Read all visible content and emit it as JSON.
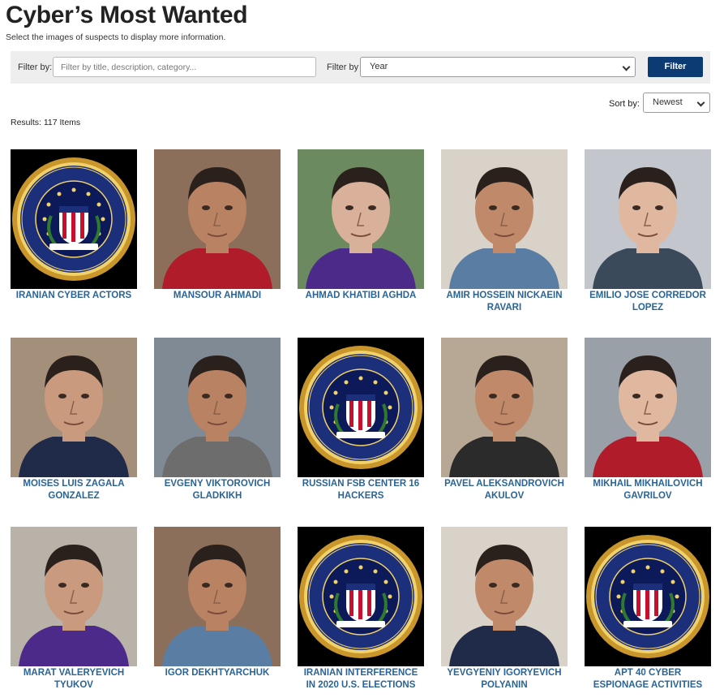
{
  "header": {
    "title": "Cyber’s Most Wanted",
    "subtitle": "Select the images of suspects to display more information."
  },
  "filters": {
    "text_label": "Filter by:",
    "text_placeholder": "Filter by title, description, category...",
    "year_label": "Filter by",
    "year_value": "Year",
    "button_label": "Filter"
  },
  "sort": {
    "label": "Sort by:",
    "value": "Newest"
  },
  "results_text": "Results: 117 Items",
  "colors": {
    "accent": "#0c3b74",
    "link": "#2a6496",
    "filter_bar": "#eeeeee"
  },
  "items": [
    {
      "name": "IRANIAN CYBER ACTORS",
      "image": "fbi-seal"
    },
    {
      "name": "MANSOUR AHMADI",
      "image": "portrait"
    },
    {
      "name": "AHMAD KHATIBI AGHDA",
      "image": "portrait"
    },
    {
      "name": "AMIR HOSSEIN NICKAEIN RAVARI",
      "image": "portrait"
    },
    {
      "name": "EMILIO JOSE CORREDOR LOPEZ",
      "image": "portrait"
    },
    {
      "name": "MOISES LUIS ZAGALA GONZALEZ",
      "image": "portrait"
    },
    {
      "name": "EVGENY VIKTOROVICH GLADKIKH",
      "image": "portrait"
    },
    {
      "name": "RUSSIAN FSB CENTER 16 HACKERS",
      "image": "fbi-seal"
    },
    {
      "name": "PAVEL ALEKSANDROVICH AKULOV",
      "image": "portrait"
    },
    {
      "name": "MIKHAIL MIKHAILOVICH GAVRILOV",
      "image": "portrait"
    },
    {
      "name": "MARAT VALERYEVICH TYUKOV",
      "image": "portrait"
    },
    {
      "name": "IGOR DEKHTYARCHUK",
      "image": "portrait"
    },
    {
      "name": "IRANIAN INTERFERENCE IN 2020 U.S. ELECTIONS",
      "image": "fbi-seal"
    },
    {
      "name": "YEVGYENIY IGORYEVICH POLYANIN",
      "image": "portrait"
    },
    {
      "name": "APT 40 CYBER ESPIONAGE ACTIVITIES",
      "image": "fbi-seal"
    }
  ]
}
